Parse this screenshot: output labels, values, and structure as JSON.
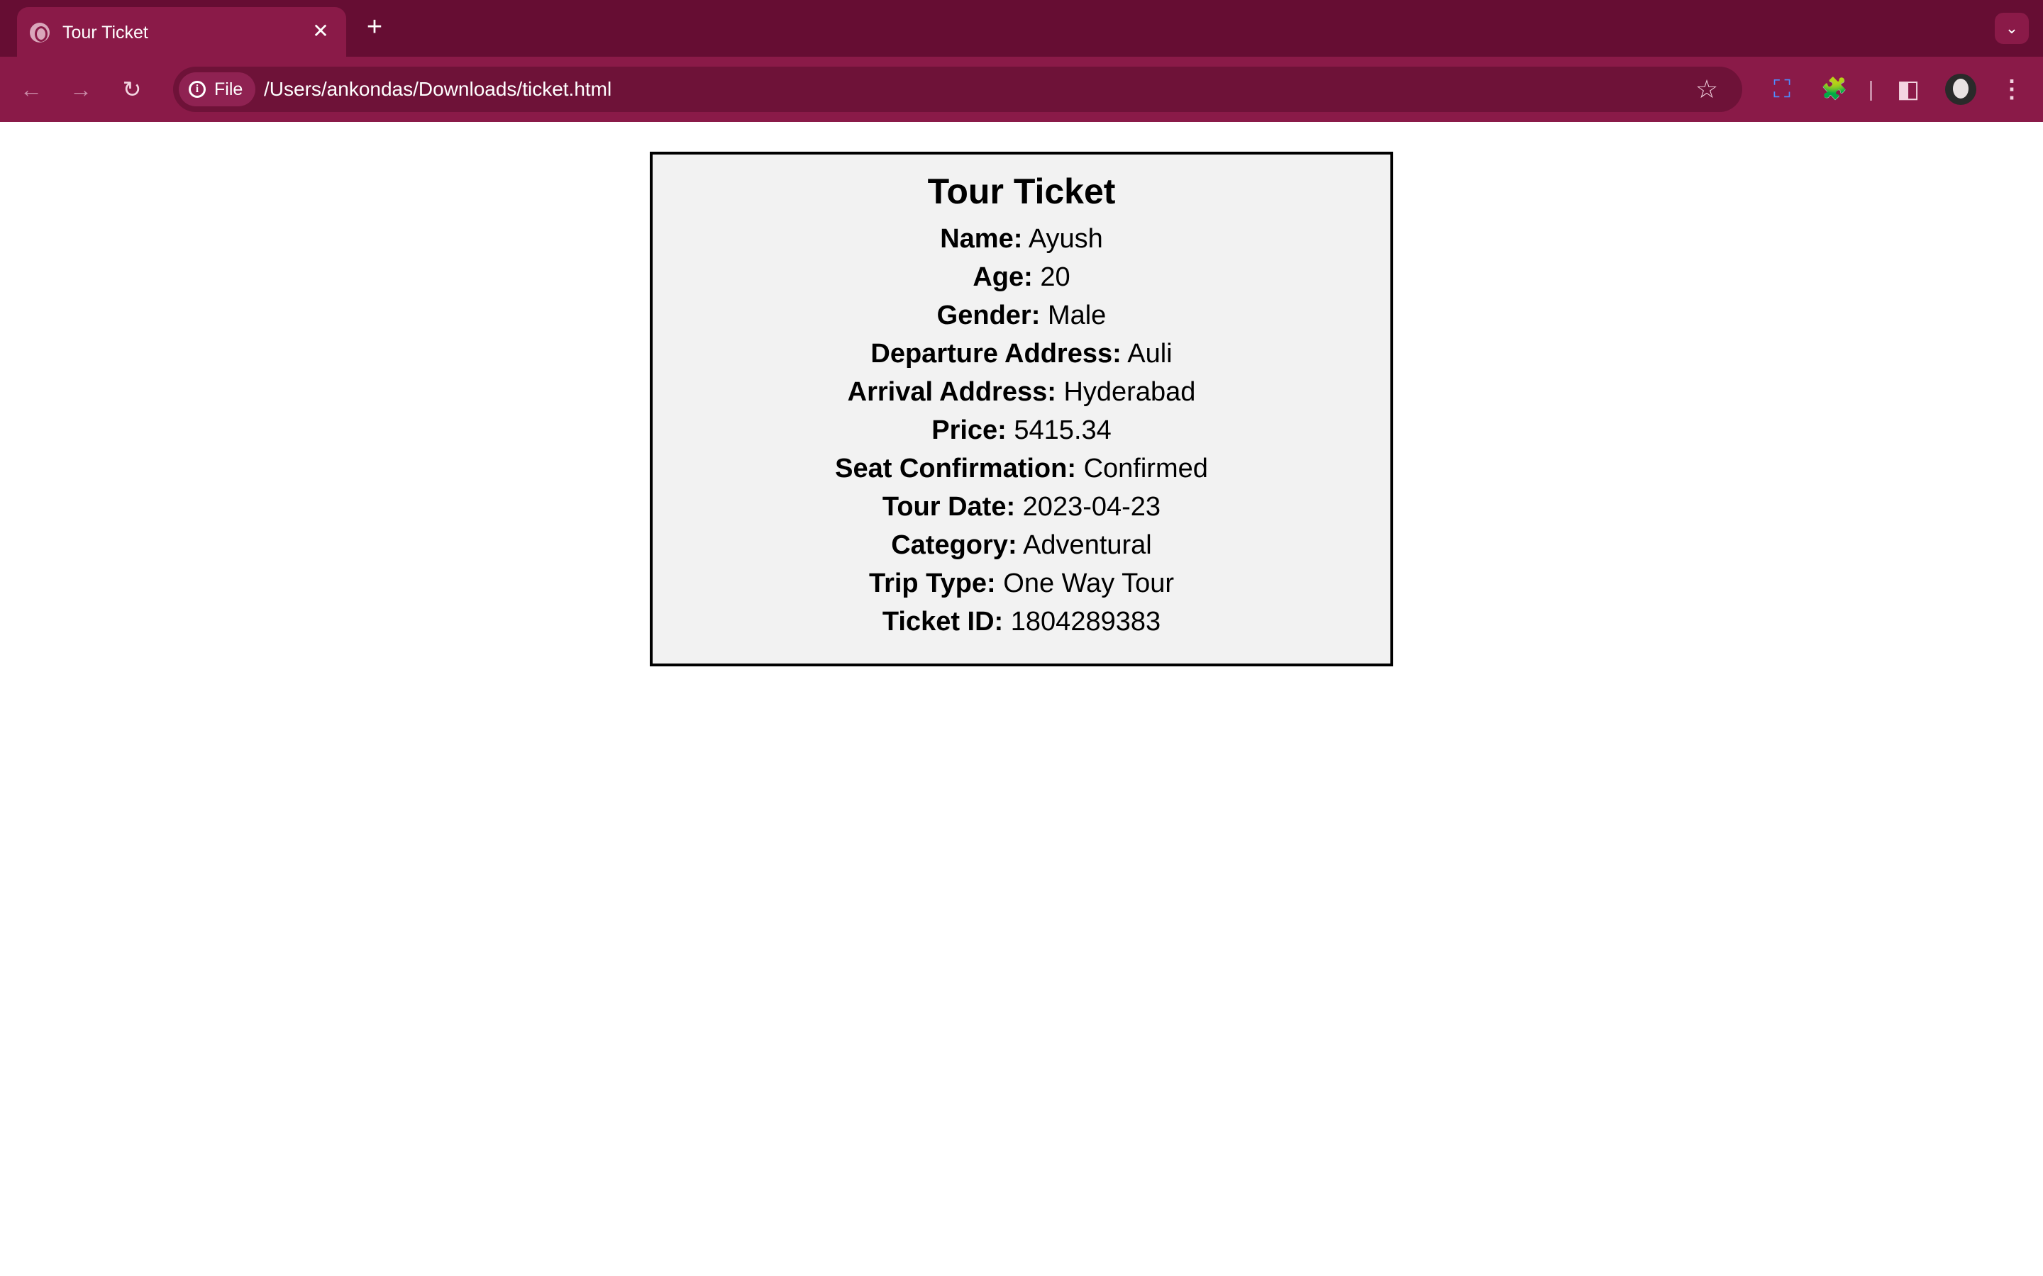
{
  "browser": {
    "tab_title": "Tour Ticket",
    "close_glyph": "✕",
    "newtab_glyph": "+",
    "tabsearch_glyph": "⌄",
    "site_info_label": "File",
    "url": "/Users/ankondas/Downloads/ticket.html",
    "icons": {
      "back": "←",
      "forward": "→",
      "reload": "↻",
      "star": "☆",
      "screenshot": "⛶",
      "extensions": "🧩",
      "sidepanel": "◧",
      "menu": "⋮"
    },
    "accent_colors": {
      "tabstrip": "#660d33",
      "toolbar": "#8a1a48"
    }
  },
  "ticket": {
    "title": "Tour Ticket",
    "fields": [
      {
        "label": "Name:",
        "value": "Ayush"
      },
      {
        "label": "Age:",
        "value": "20"
      },
      {
        "label": "Gender:",
        "value": "Male"
      },
      {
        "label": "Departure Address:",
        "value": "Auli"
      },
      {
        "label": "Arrival Address:",
        "value": "Hyderabad"
      },
      {
        "label": "Price:",
        "value": "5415.34"
      },
      {
        "label": "Seat Confirmation:",
        "value": "Confirmed"
      },
      {
        "label": "Tour Date:",
        "value": "2023-04-23"
      },
      {
        "label": "Category:",
        "value": "Adventural"
      },
      {
        "label": "Trip Type:",
        "value": "One Way Tour"
      },
      {
        "label": "Ticket ID:",
        "value": "1804289383"
      }
    ]
  }
}
